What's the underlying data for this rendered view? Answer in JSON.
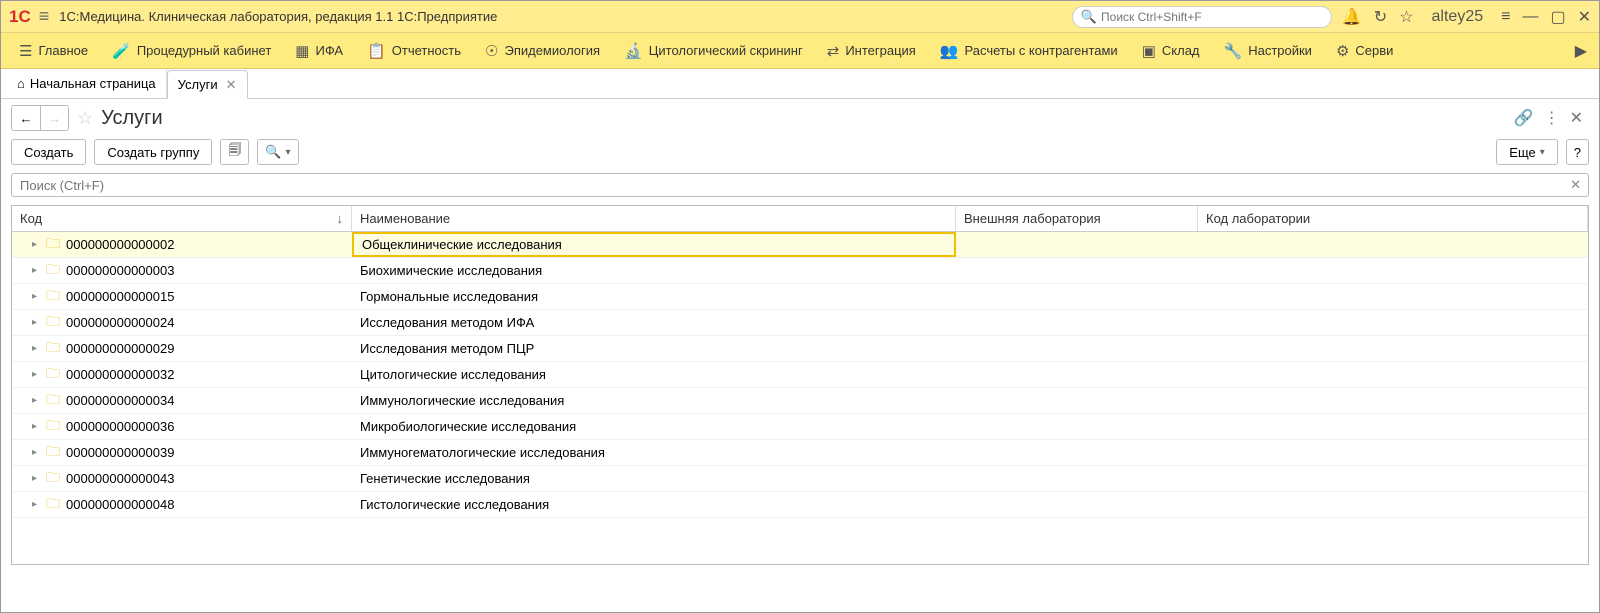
{
  "titlebar": {
    "app_title": "1С:Медицина. Клиническая лаборатория, редакция 1.1 1С:Предприятие",
    "logo_text": "1C",
    "search_placeholder": "Поиск Ctrl+Shift+F",
    "username": "altey25"
  },
  "menu": {
    "items": [
      {
        "icon": "☰",
        "label": "Главное"
      },
      {
        "icon": "🧪",
        "label": "Процедурный кабинет"
      },
      {
        "icon": "▦",
        "label": "ИФА"
      },
      {
        "icon": "📋",
        "label": "Отчетность"
      },
      {
        "icon": "☉",
        "label": "Эпидемиология"
      },
      {
        "icon": "🔬",
        "label": "Цитологический скрининг"
      },
      {
        "icon": "⇄",
        "label": "Интеграция"
      },
      {
        "icon": "👥",
        "label": "Расчеты с контрагентами"
      },
      {
        "icon": "▣",
        "label": "Склад"
      },
      {
        "icon": "🔧",
        "label": "Настройки"
      },
      {
        "icon": "⚙",
        "label": "Серви"
      }
    ]
  },
  "tabs": {
    "home": "Начальная страница",
    "active": "Услуги"
  },
  "page": {
    "title": "Услуги"
  },
  "toolbar": {
    "create": "Создать",
    "create_group": "Создать группу",
    "more": "Еще"
  },
  "filter": {
    "placeholder": "Поиск (Ctrl+F)"
  },
  "table": {
    "headers": {
      "code": "Код",
      "name": "Наименование",
      "ext_lab": "Внешняя лаборатория",
      "lab_code": "Код лаборатории"
    },
    "rows": [
      {
        "code": "000000000000002",
        "name": "Общеклинические исследования",
        "selected": true
      },
      {
        "code": "000000000000003",
        "name": "Биохимические исследования"
      },
      {
        "code": "000000000000015",
        "name": "Гормональные исследования"
      },
      {
        "code": "000000000000024",
        "name": "Исследования методом ИФА"
      },
      {
        "code": "000000000000029",
        "name": "Исследования методом ПЦР"
      },
      {
        "code": "000000000000032",
        "name": "Цитологические исследования"
      },
      {
        "code": "000000000000034",
        "name": "Иммунологические исследования"
      },
      {
        "code": "000000000000036",
        "name": "Микробиологические исследования"
      },
      {
        "code": "000000000000039",
        "name": "Иммуногематологические исследования"
      },
      {
        "code": "000000000000043",
        "name": "Генетические исследования"
      },
      {
        "code": "000000000000048",
        "name": "Гистологические исследования"
      }
    ]
  }
}
